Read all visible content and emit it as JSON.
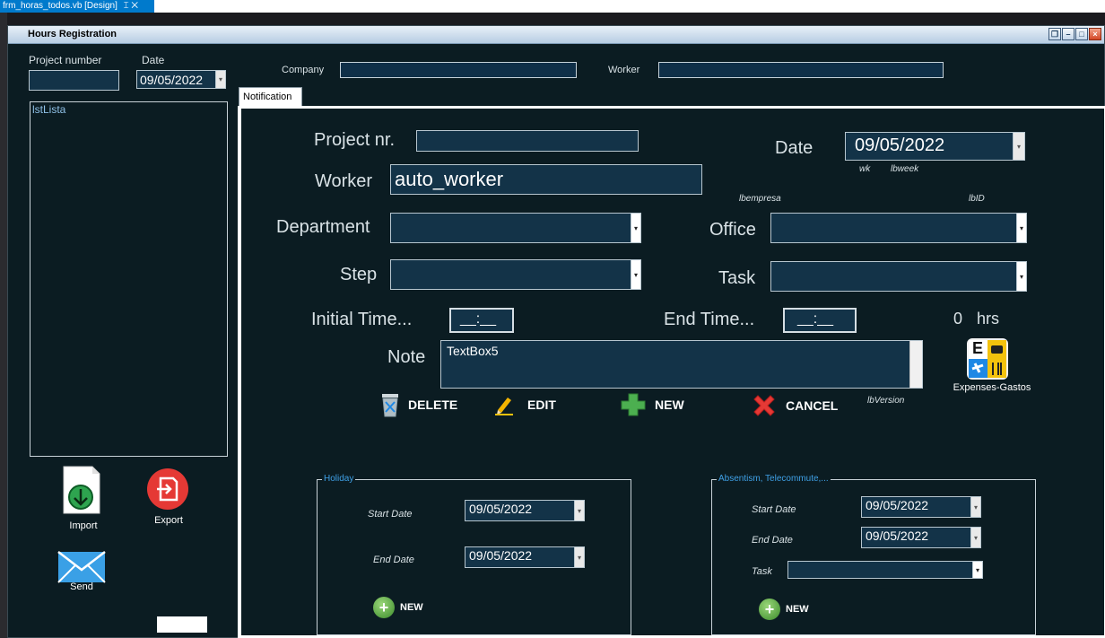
{
  "ide": {
    "tab_title": "frm_horas_todos.vb [Design]",
    "pin": "⌶",
    "close": "✕"
  },
  "window": {
    "title": "Hours Registration"
  },
  "header": {
    "project_number_label": "Project number",
    "date_label": "Date",
    "date_value": "09/05/2022",
    "company_label": "Company",
    "worker_label": "Worker"
  },
  "list": {
    "label": "lstLista"
  },
  "left_actions": {
    "import": "Import",
    "export": "Export",
    "send": "Send"
  },
  "tab": {
    "label": "Notification"
  },
  "notification": {
    "project_nr_label": "Project nr.",
    "date_label": "Date",
    "date_value": "09/05/2022",
    "wk_label": "wk",
    "lbweek_label": "lbweek",
    "worker_label": "Worker",
    "worker_value": "auto_worker",
    "lbempresa_label": "lbempresa",
    "lbid_label": "lbID",
    "department_label": "Department",
    "office_label": "Office",
    "step_label": "Step",
    "task_label": "Task",
    "initial_time_label": "Initial Time...",
    "initial_time_value": "__:__",
    "end_time_label": "End Time...",
    "end_time_value": "__:__",
    "hours_value": "0",
    "hours_unit": "hrs",
    "note_label": "Note",
    "note_value": "TextBox5",
    "lbversion_label": "lbVersion",
    "expenses_label": "Expenses-Gastos",
    "expenses_icon_letter": "E"
  },
  "actions": {
    "delete": "DELETE",
    "edit": "EDIT",
    "new": "NEW",
    "cancel": "CANCEL"
  },
  "holiday": {
    "title": "Holiday",
    "start_label": "Start Date",
    "start_value": "09/05/2022",
    "end_label": "End Date",
    "end_value": "09/05/2022",
    "new_label": "NEW"
  },
  "absentism": {
    "title": "Absentism, Telecommute,...",
    "start_label": "Start Date",
    "start_value": "09/05/2022",
    "end_label": "End Date",
    "end_value": "09/05/2022",
    "task_label": "Task",
    "new_label": "NEW"
  },
  "colors": {
    "background": "#0b1c22",
    "field": "#133348",
    "accent": "#007acc"
  }
}
